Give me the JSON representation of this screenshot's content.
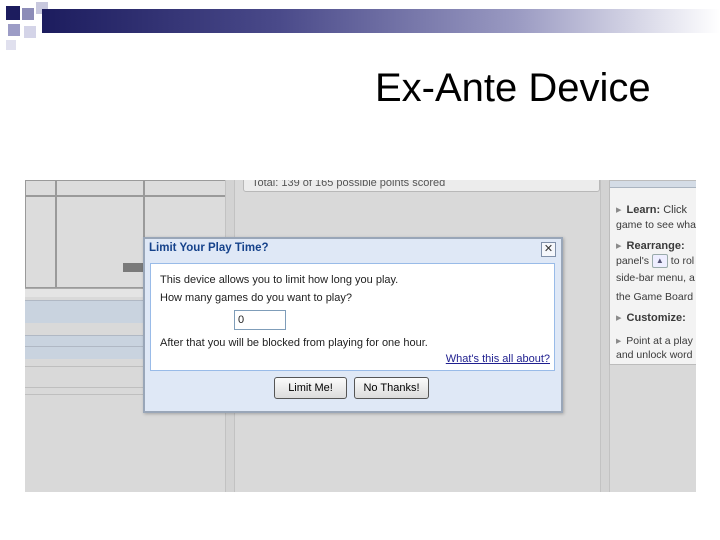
{
  "slide": {
    "title": "Ex-Ante Device"
  },
  "game": {
    "score_text": "Total: 139 of 165 possible points scored"
  },
  "help_panel": {
    "sections": [
      {
        "heading": "Learn:",
        "heading_tail": "Click",
        "lines": [
          "game to see wha"
        ]
      },
      {
        "heading": "Rearrange:",
        "heading_tail": "",
        "lines": [
          "panel's",
          "to rol",
          "side-bar menu, a",
          "the Game Board p"
        ]
      },
      {
        "heading": "Customize:",
        "heading_tail": "",
        "lines": []
      },
      {
        "heading": "",
        "heading_tail": "Point at a play",
        "lines": [
          "and unlock word"
        ]
      }
    ]
  },
  "dialog": {
    "title": "Limit Your Play Time?",
    "close_glyph": "✕",
    "line1": "This device allows you to limit how long you play.",
    "line2": "How many games do you want to play?",
    "games_value": "0",
    "line3": "After that you will be blocked from playing for one hour.",
    "help_link": "What's this all about?",
    "limit_button": "Limit Me!",
    "no_button": "No Thanks!"
  },
  "colors": {
    "slide_bar_dark": "#1c1c5e",
    "dialog_title": "#15428b",
    "dialog_bg": "#dfe8f6"
  }
}
